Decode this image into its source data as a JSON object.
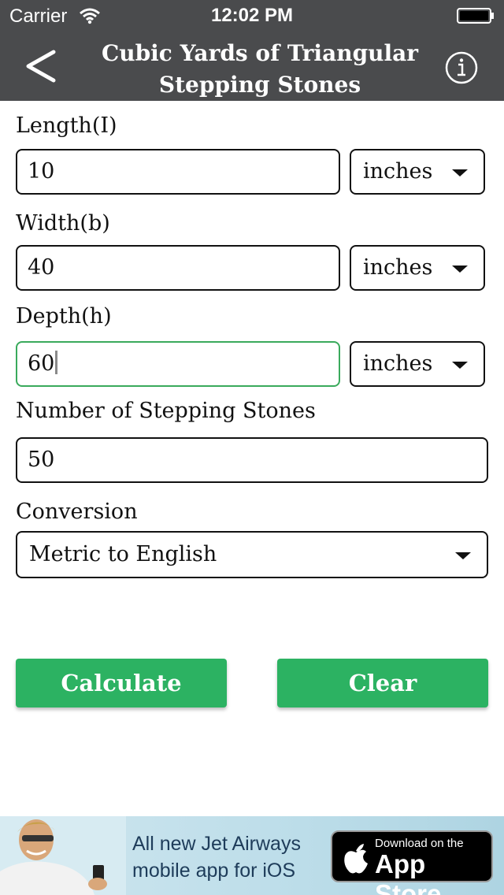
{
  "status_bar": {
    "carrier": "Carrier",
    "time": "12:02 PM"
  },
  "nav": {
    "title_line1": "Cubic Yards of Triangular",
    "title_line2": "Stepping Stones",
    "back_icon": "chevron-left-icon",
    "info_icon": "info-icon"
  },
  "form": {
    "length": {
      "label": "Length(I)",
      "value": "10",
      "unit": "inches"
    },
    "width": {
      "label": "Width(b)",
      "value": "40",
      "unit": "inches"
    },
    "depth": {
      "label": "Depth(h)",
      "value": "60",
      "unit": "inches"
    },
    "stones": {
      "label": "Number of Stepping Stones",
      "value": "50"
    },
    "conversion": {
      "label": "Conversion",
      "value": "Metric to English"
    }
  },
  "buttons": {
    "calculate": "Calculate",
    "clear": "Clear"
  },
  "ad": {
    "line1": "All new Jet Airways",
    "line2": "mobile app for iOS",
    "badge_small": "Download on the",
    "badge_big": "App Store"
  },
  "colors": {
    "header": "#4a4b4d",
    "accent": "#2cb262",
    "active_border": "#3aaa5c"
  }
}
